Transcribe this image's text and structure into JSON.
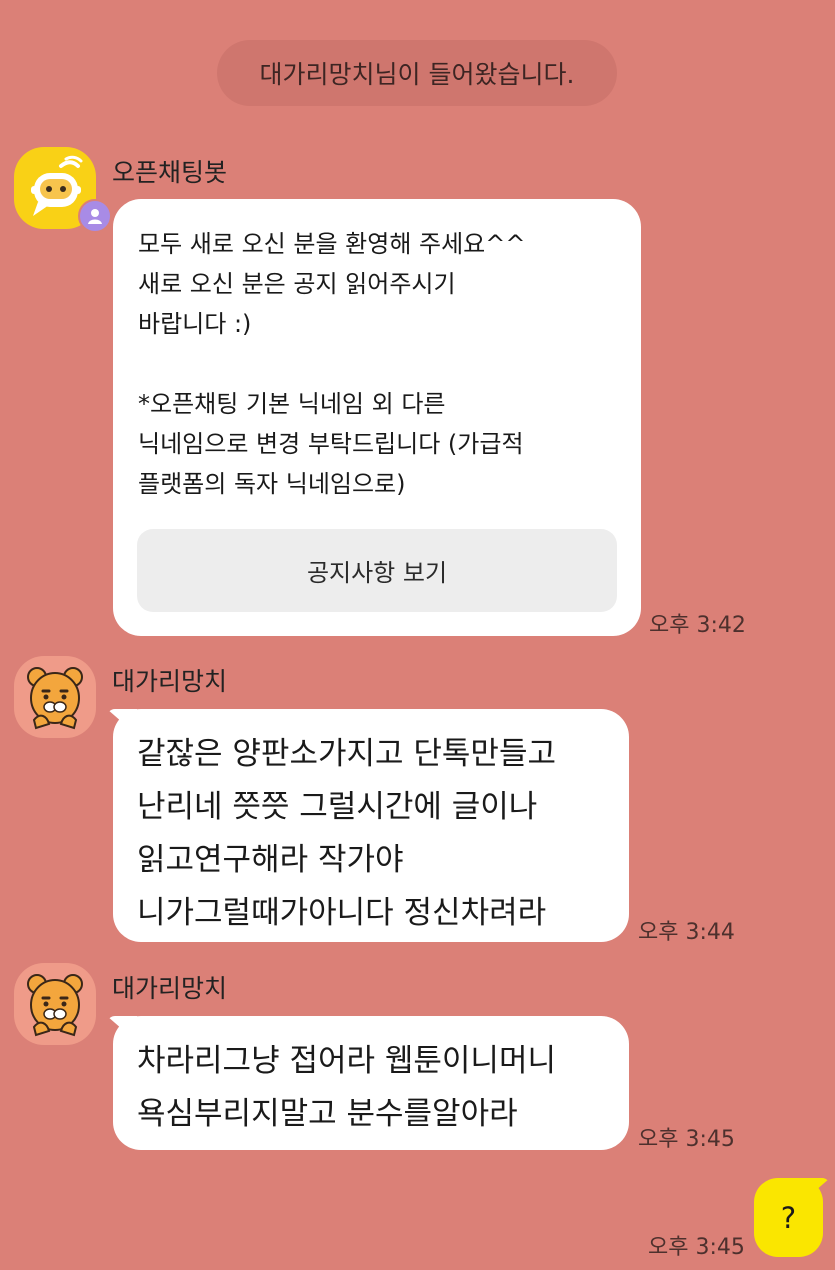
{
  "system_notice": "대가리망치님이 들어왔습니다.",
  "icons": {
    "bot_avatar": "chat-bot-avatar-icon",
    "bot_badge": "bot-badge-icon",
    "user_avatar": "ryan-avatar-icon"
  },
  "colors": {
    "chat_background": "#db8077",
    "received_bubble": "#ffffff",
    "sent_bubble": "#fae600",
    "system_notice": "#cf766e"
  },
  "messages": [
    {
      "sender": "오픈채팅봇",
      "text": "모두 새로 오신 분을 환영해 주세요^^\n새로 오신 분은 공지 읽어주시기\n바랍니다 :)\n\n*오픈채팅 기본 닉네임 외 다른\n닉네임으로 변경 부탁드립니다 (가급적\n플랫폼의 독자 닉네임으로)",
      "button_label": "공지사항 보기",
      "time": "오후 3:42"
    },
    {
      "sender": "대가리망치",
      "text": "같잖은 양판소가지고 단톡만들고\n난리네 쯧쯧 그럴시간에 글이나\n읽고연구해라 작가야\n니가그럴때가아니다 정신차려라",
      "time": "오후 3:44"
    },
    {
      "sender": "대가리망치",
      "text": "차라리그냥 접어라 웹툰이니머니\n욕심부리지말고 분수를알아라",
      "time": "오후 3:45"
    },
    {
      "sender": "",
      "text": "?",
      "time": "오후 3:45"
    }
  ]
}
